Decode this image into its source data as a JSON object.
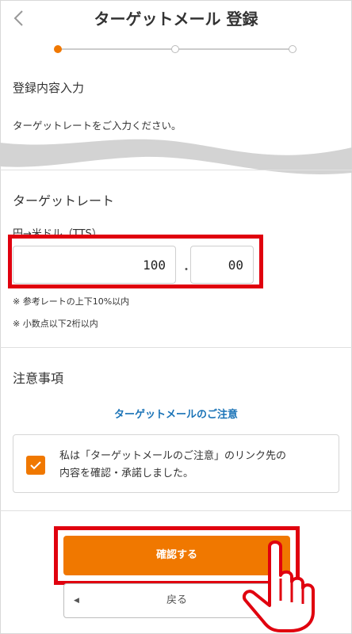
{
  "header": {
    "title": "ターゲットメール 登録",
    "back_icon": "chevron-left-icon"
  },
  "stepper": {
    "steps": 3,
    "current": 1
  },
  "section1": {
    "heading": "登録内容入力",
    "description": "ターゲットレートをご入力ください。"
  },
  "section2": {
    "heading": "ターゲットレート",
    "pair_label": "円→米ドル（TTS）",
    "integer_value": "100",
    "separator": "・",
    "decimal_value": "00",
    "notes": [
      "※ 参考レートの上下10%以内",
      "※ 小数点以下2桁以内"
    ]
  },
  "section3": {
    "heading": "注意事項",
    "link_text": "ターゲットメールのご注意",
    "consent_line1": "私は「ターゲットメールのご注意」のリンク先の",
    "consent_line2": "内容を確認・承諾しました。",
    "checked": true
  },
  "actions": {
    "confirm_label": "確認する",
    "back_label": "戻る"
  },
  "colors": {
    "accent": "#f07800",
    "highlight": "#e0000e",
    "link": "#1a73b7"
  }
}
